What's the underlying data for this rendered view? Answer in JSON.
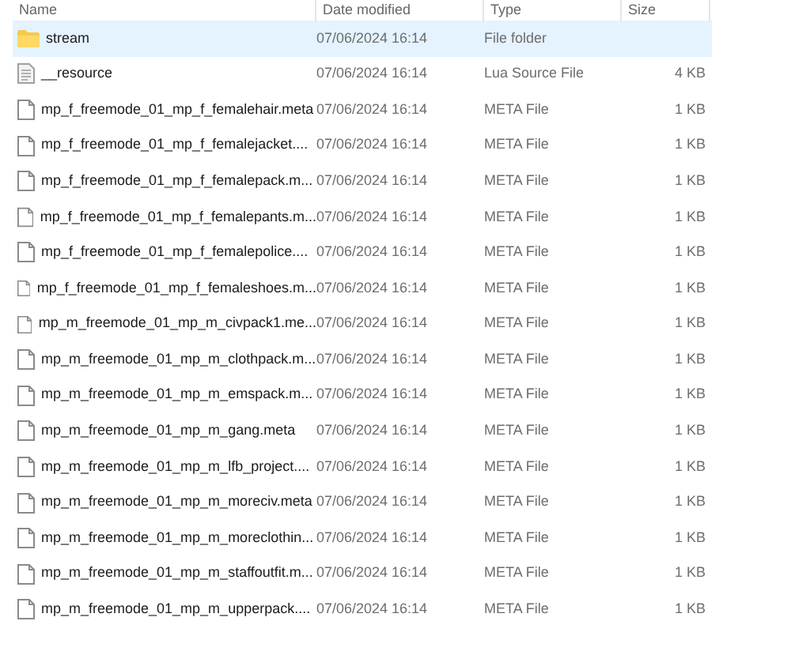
{
  "columns": [
    "Name",
    "Date modified",
    "Type",
    "Size"
  ],
  "rows": [
    {
      "kind": "folder",
      "name": "stream",
      "date": "07/06/2024 16:14",
      "type": "File folder",
      "selected": true
    },
    {
      "kind": "lua",
      "name": "__resource",
      "date": "07/06/2024 16:14",
      "type": "Lua Source File",
      "size": "4 KB",
      "selected": false
    },
    {
      "kind": "file",
      "name": "mp_f_freemode_01_mp_f_femalehair.meta",
      "date": "07/06/2024 16:14",
      "type": "META File",
      "size": "1 KB",
      "selected": false
    },
    {
      "kind": "file",
      "name": "mp_f_freemode_01_mp_f_femalejacket....",
      "date": "07/06/2024 16:14",
      "type": "META File",
      "size": "1 KB",
      "selected": false
    },
    {
      "kind": "file",
      "name": "mp_f_freemode_01_mp_f_femalepack.m...",
      "date": "07/06/2024 16:14",
      "type": "META File",
      "size": "1 KB",
      "selected": false
    },
    {
      "kind": "file",
      "name": "mp_f_freemode_01_mp_f_femalepants.m...",
      "date": "07/06/2024 16:14",
      "type": "META File",
      "size": "1 KB",
      "selected": false
    },
    {
      "kind": "file",
      "name": "mp_f_freemode_01_mp_f_femalepolice....",
      "date": "07/06/2024 16:14",
      "type": "META File",
      "size": "1 KB",
      "selected": false
    },
    {
      "kind": "file",
      "name": "mp_f_freemode_01_mp_f_femaleshoes.m...",
      "date": "07/06/2024 16:14",
      "type": "META File",
      "size": "1 KB",
      "selected": false
    },
    {
      "kind": "file",
      "name": "mp_m_freemode_01_mp_m_civpack1.me...",
      "date": "07/06/2024 16:14",
      "type": "META File",
      "size": "1 KB",
      "selected": false
    },
    {
      "kind": "file",
      "name": "mp_m_freemode_01_mp_m_clothpack.m...",
      "date": "07/06/2024 16:14",
      "type": "META File",
      "size": "1 KB",
      "selected": false
    },
    {
      "kind": "file",
      "name": "mp_m_freemode_01_mp_m_emspack.m...",
      "date": "07/06/2024 16:14",
      "type": "META File",
      "size": "1 KB",
      "selected": false
    },
    {
      "kind": "file",
      "name": "mp_m_freemode_01_mp_m_gang.meta",
      "date": "07/06/2024 16:14",
      "type": "META File",
      "size": "1 KB",
      "selected": false
    },
    {
      "kind": "file",
      "name": "mp_m_freemode_01_mp_m_lfb_project....",
      "date": "07/06/2024 16:14",
      "type": "META File",
      "size": "1 KB",
      "selected": false
    },
    {
      "kind": "file",
      "name": "mp_m_freemode_01_mp_m_moreciv.meta",
      "date": "07/06/2024 16:14",
      "type": "META File",
      "size": "1 KB",
      "selected": false
    },
    {
      "kind": "file",
      "name": "mp_m_freemode_01_mp_m_moreclothin...",
      "date": "07/06/2024 16:14",
      "type": "META File",
      "size": "1 KB",
      "selected": false
    },
    {
      "kind": "file",
      "name": "mp_m_freemode_01_mp_m_staffoutfit.m...",
      "date": "07/06/2024 16:14",
      "type": "META File",
      "size": "1 KB",
      "selected": false
    },
    {
      "kind": "file",
      "name": "mp_m_freemode_01_mp_m_upperpack....",
      "date": "07/06/2024 16:14",
      "type": "META File",
      "size": "1 KB",
      "selected": false
    }
  ]
}
